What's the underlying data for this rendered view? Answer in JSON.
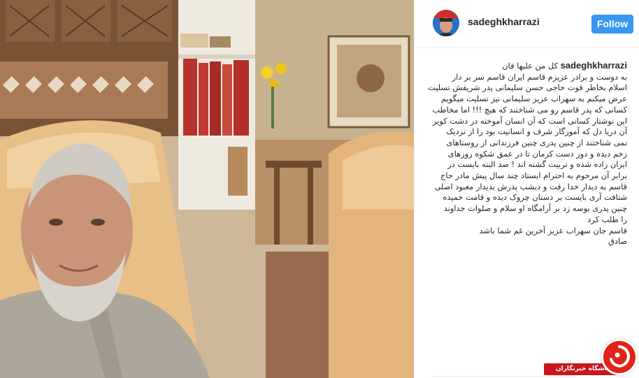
{
  "post": {
    "username": "sadeghkharrazi",
    "follow_label": "Follow",
    "caption": {
      "author": "sadeghkharrazi",
      "first_line": "کل من علیها فان",
      "lines": [
        "به دوست و برادر عزیزم قاسم ایران قاسم سر بر دار",
        "اسلام بخاطر فوت حاجی حسن سلیمانی پدر شریفش تسلیت",
        "عرض میکنم به سهراب عزیز سلیمانی نیز تسلیت میگویم",
        "کسانی که پدر قاسم رو می شناختند که هیچ !!! اما مخاطب",
        "این نوشتار کسانی است که آن انسان آموخته در دشت کویر",
        "آن دریا دل که آموزگار شرف و انسانیت بود را از نزدیک",
        "نمی شناختند از چنین پدری چنین فرزندانی از روستاهای",
        "زخم دیده و دور دست کرمان تا در عمق شکوه روزهای",
        "ایران زاده شده و تربیت گشته اند ! صد البته بایست در",
        "برابر آن مرحوم به احترام ایستاد چند سال پیش مادر حاج",
        "قاسم به دیدار خدا رفت و دیشب پدرش بدیدار معبود اصلی",
        "شتافت آری بایست بر دستان چروک دیده و قامت خمیده",
        "چنین پدری بوسه زد بر آرامگاه او سلام و صلوات خداوند",
        "را طلب کرد",
        "قاسم جان سهراب عزیز آخرین غم شما باشد",
        "صادق"
      ]
    }
  },
  "watermark": {
    "text": "باشگاه خبرنگاران"
  },
  "colors": {
    "follow_bg": "#3897f0",
    "watermark_red": "#c8161d"
  },
  "icons": {
    "watermark_logo": "jam-newsroom-logo-icon"
  }
}
